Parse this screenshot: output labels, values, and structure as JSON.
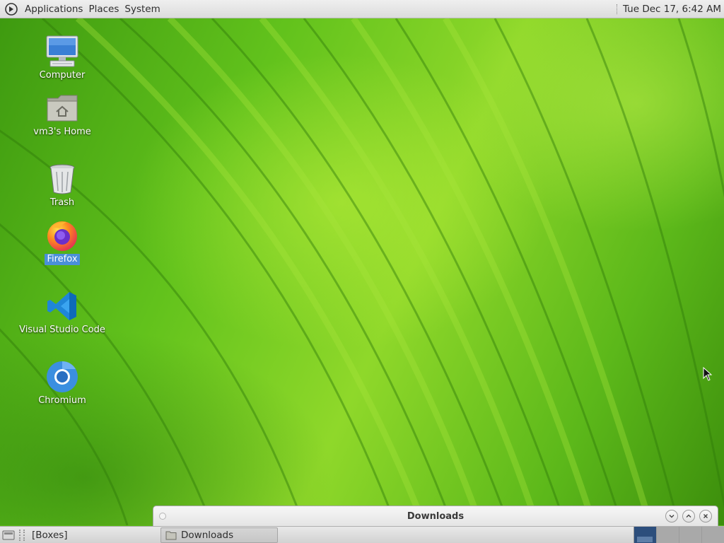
{
  "top_panel": {
    "menus": [
      "Applications",
      "Places",
      "System"
    ],
    "clock": "Tue Dec 17,  6:42 AM"
  },
  "desktop": {
    "icons": [
      {
        "label": "Computer",
        "icon": "computer-icon",
        "selected": false
      },
      {
        "label": "vm3's Home",
        "icon": "home-folder-icon",
        "selected": false
      },
      {
        "label": "Trash",
        "icon": "trash-icon",
        "selected": false
      },
      {
        "label": "Firefox",
        "icon": "firefox-icon",
        "selected": true
      },
      {
        "label": "Visual Studio Code",
        "icon": "vscode-icon",
        "selected": false
      },
      {
        "label": "Chromium",
        "icon": "chromium-icon",
        "selected": false
      }
    ]
  },
  "window": {
    "title": "Downloads",
    "controls": [
      "minimize-icon",
      "maximize-icon",
      "close-icon"
    ]
  },
  "bottom_panel": {
    "tasks": [
      {
        "label": "[Boxes]",
        "active": false
      },
      {
        "label": "Downloads",
        "active": true
      }
    ],
    "workspaces": 4,
    "active_workspace": 1
  },
  "colors": {
    "selection": "#4a90d9",
    "wallpaper_green": "#5cb81a",
    "workspace_active": "#2c4e7c"
  }
}
